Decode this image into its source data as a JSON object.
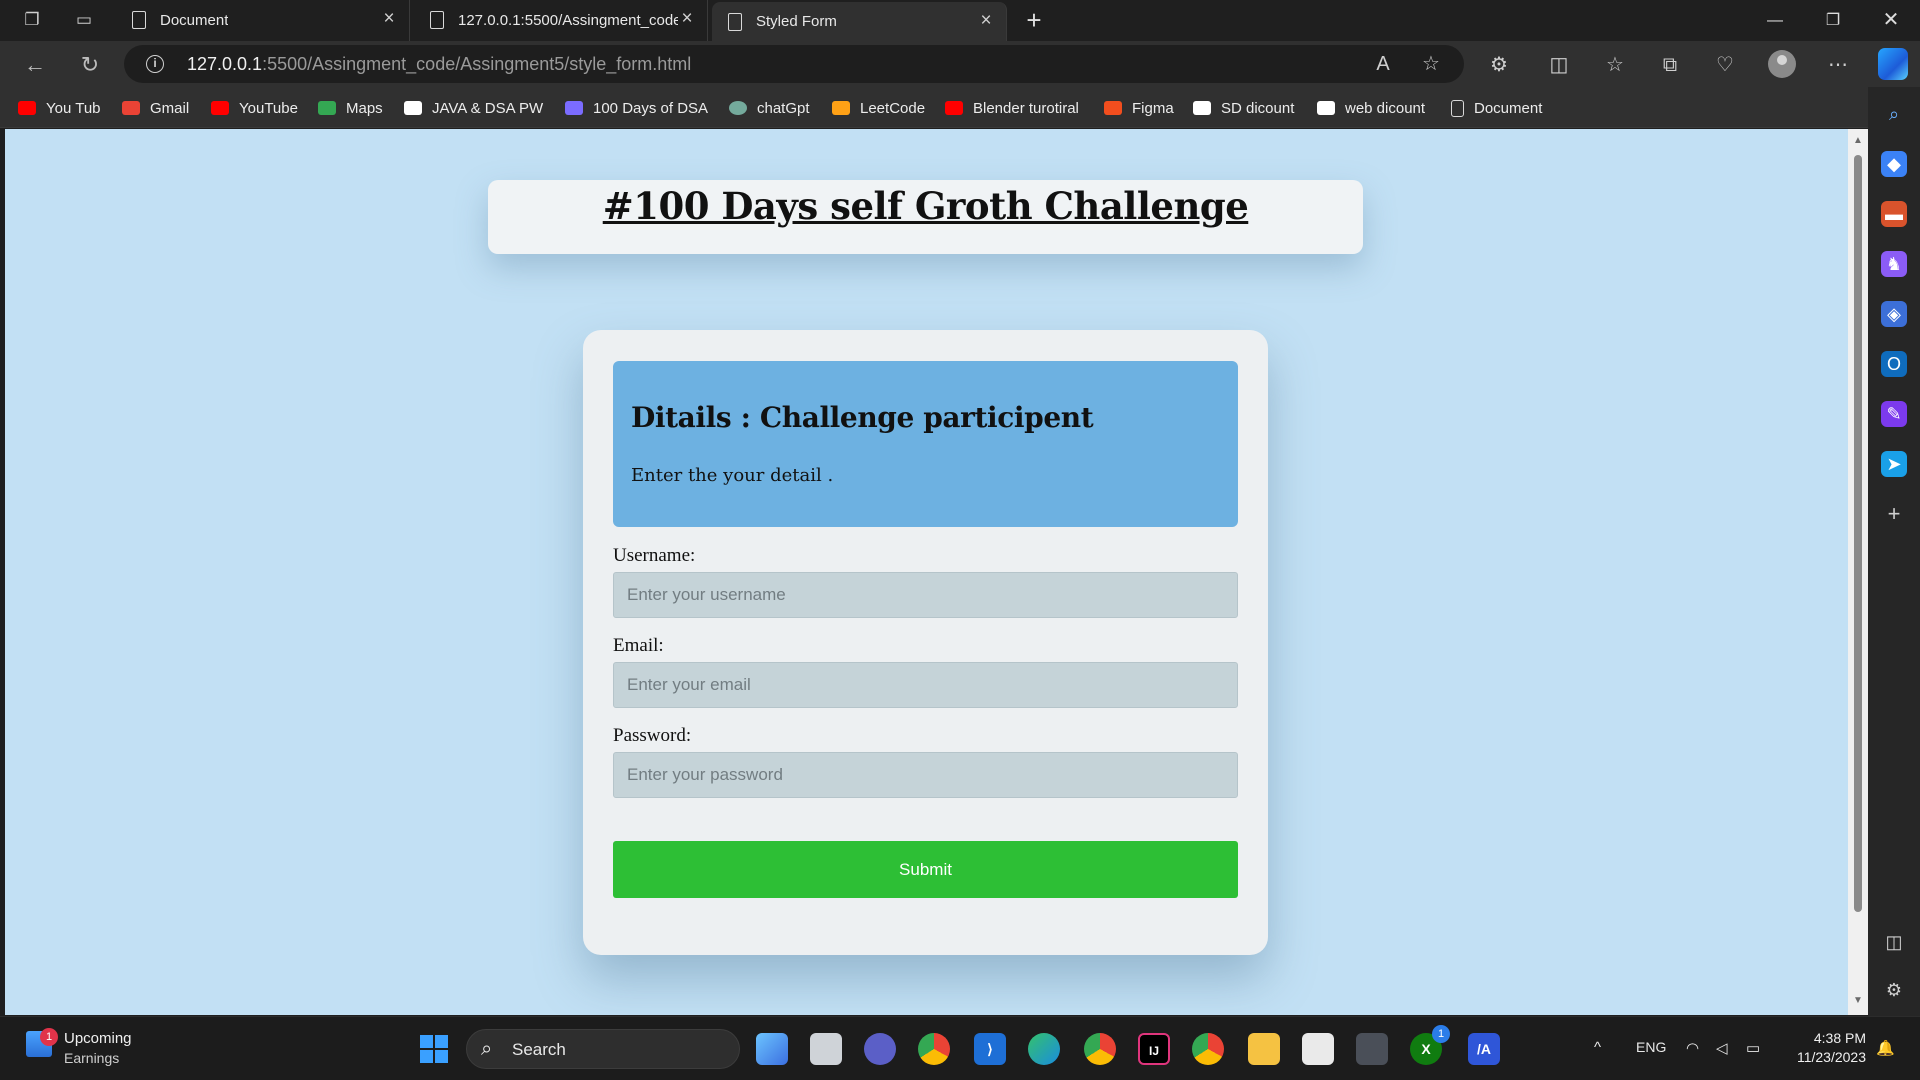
{
  "browser": {
    "tabs": [
      {
        "title": "Document",
        "active": false
      },
      {
        "title": "127.0.0.1:5500/Assingment_code",
        "active": false
      },
      {
        "title": "Styled Form",
        "active": true
      }
    ],
    "url_host": "127.0.0.1",
    "url_rest": ":5500/Assingment_code/Assingment5/style_form.html",
    "bookmarks": [
      {
        "label": "You Tub",
        "icon": "youtube-icon",
        "color": "#ff0000"
      },
      {
        "label": "Gmail",
        "icon": "gmail-icon",
        "color": "#ea4335"
      },
      {
        "label": "YouTube",
        "icon": "youtube-icon",
        "color": "#ff0000"
      },
      {
        "label": "Maps",
        "icon": "maps-icon",
        "color": "#34a853"
      },
      {
        "label": "JAVA & DSA  PW",
        "icon": "pw-icon",
        "color": "#ffffff"
      },
      {
        "label": "100 Days of DSA",
        "icon": "calendar-icon",
        "color": "#7b6cff"
      },
      {
        "label": "chatGpt",
        "icon": "chatgpt-icon",
        "color": "#74aa9c"
      },
      {
        "label": "LeetCode",
        "icon": "leetcode-icon",
        "color": "#ffa116"
      },
      {
        "label": "Blender turotiral",
        "icon": "youtube-icon",
        "color": "#ff0000"
      },
      {
        "label": "Figma",
        "icon": "figma-icon",
        "color": "#f24e1e"
      },
      {
        "label": "SD dicount",
        "icon": "pw-icon",
        "color": "#ffffff"
      },
      {
        "label": "web dicount",
        "icon": "pw-icon",
        "color": "#ffffff"
      },
      {
        "label": "Document",
        "icon": "document-icon",
        "color": "#d9d9d9"
      }
    ]
  },
  "page": {
    "header_title": "#100 Days self Groth Challenge",
    "details_title": "Ditails : Challenge participent",
    "details_subtitle": "Enter the your detail .",
    "username_label": "Username:",
    "username_placeholder": "Enter your username",
    "email_label": "Email:",
    "email_placeholder": "Enter your email",
    "password_label": "Password:",
    "password_placeholder": "Enter your password",
    "submit_label": "Submit"
  },
  "taskbar": {
    "widget_badge": "1",
    "widget_title": "Upcoming",
    "widget_subtitle": "Earnings",
    "search_label": "Search",
    "lang": "ENG",
    "time": "4:38 PM",
    "date": "11/23/2023",
    "xbox_badge": "1"
  },
  "colors": {
    "page_bg": "#c2e0f4",
    "details_bg": "#6db1e1",
    "submit_bg": "#2dbf35",
    "input_bg": "#c5d3d8"
  }
}
